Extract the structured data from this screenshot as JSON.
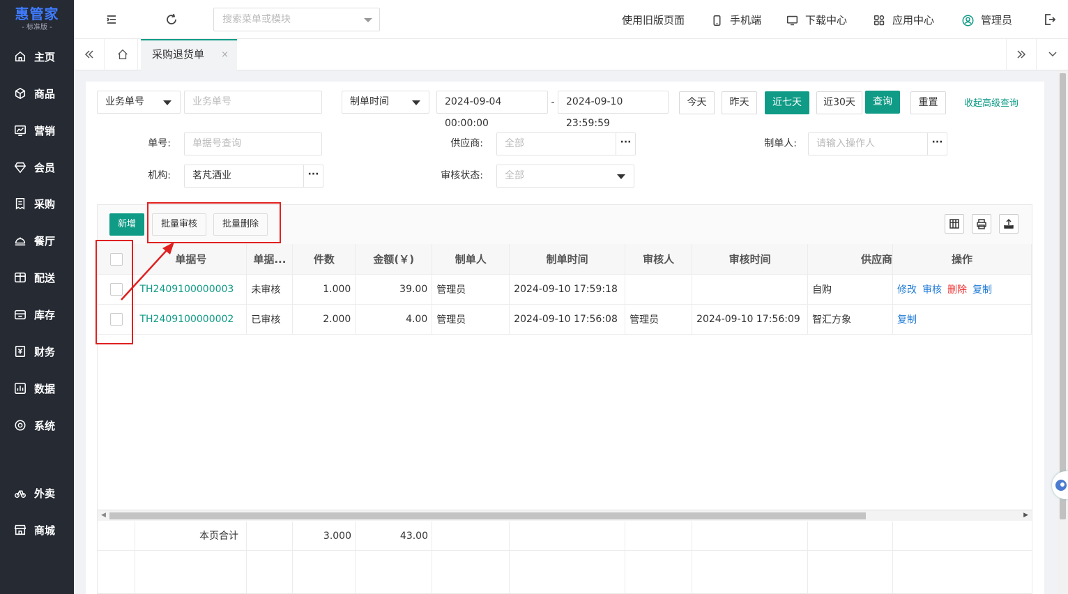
{
  "logo": {
    "brand": "惠管家",
    "edition": "- 标准版 -"
  },
  "sidebar": {
    "items": [
      {
        "label": "主页",
        "icon": "home-icon"
      },
      {
        "label": "商品",
        "icon": "box-icon"
      },
      {
        "label": "营销",
        "icon": "chart-icon"
      },
      {
        "label": "会员",
        "icon": "diamond-icon"
      },
      {
        "label": "采购",
        "icon": "receipt-icon"
      },
      {
        "label": "餐厅",
        "icon": "dome-icon"
      },
      {
        "label": "配送",
        "icon": "delivery-icon"
      },
      {
        "label": "库存",
        "icon": "warehouse-icon"
      },
      {
        "label": "财务",
        "icon": "finance-icon"
      },
      {
        "label": "数据",
        "icon": "data-icon"
      },
      {
        "label": "系统",
        "icon": "settings-icon"
      },
      {
        "label": "外卖",
        "icon": "bike-icon"
      },
      {
        "label": "商城",
        "icon": "store-icon"
      }
    ]
  },
  "topbar": {
    "search_placeholder": "搜索菜单或模块",
    "old_page": "使用旧版页面",
    "mobile": "手机端",
    "download": "下载中心",
    "apps": "应用中心",
    "user": "管理员"
  },
  "tabs": {
    "active": "采购退货单",
    "close": "×"
  },
  "filters": {
    "type_select": "业务单号",
    "type_placeholder": "业务单号",
    "time_select": "制单时间",
    "date_start": "2024-09-04 00:00:00",
    "date_sep": "-",
    "date_end": "2024-09-10 23:59:59",
    "today": "今天",
    "yesterday": "昨天",
    "last7": "近七天",
    "last30": "近30天",
    "query": "查询",
    "reset": "重置",
    "collapse": "收起高级查询",
    "order_no_label": "单号:",
    "order_no_placeholder": "单据号查询",
    "supplier_label": "供应商:",
    "supplier_placeholder": "全部",
    "creator_label": "制单人:",
    "creator_placeholder": "请输入操作人",
    "org_label": "机构:",
    "org_value": "茗芃酒业",
    "audit_label": "审核状态:",
    "audit_placeholder": "全部",
    "dots": "···"
  },
  "toolbar": {
    "add": "新增",
    "batch_audit": "批量审核",
    "batch_delete": "批量删除"
  },
  "table": {
    "headers": [
      "单据号",
      "单据...",
      "件数",
      "金额(￥)",
      "制单人",
      "制单时间",
      "审核人",
      "审核时间",
      "供应商",
      "操作"
    ],
    "rows": [
      {
        "no": "TH2409100000003",
        "status": "未审核",
        "qty": "1.000",
        "amount": "39.00",
        "creator": "管理员",
        "created": "2024-09-10 17:59:18",
        "auditor": "",
        "audited": "",
        "supplier": "自购",
        "ops": [
          "修改",
          "审核",
          "删除",
          "复制"
        ]
      },
      {
        "no": "TH2409100000002",
        "status": "已审核",
        "qty": "2.000",
        "amount": "4.00",
        "creator": "管理员",
        "created": "2024-09-10 17:56:08",
        "auditor": "管理员",
        "audited": "2024-09-10 17:56:09",
        "supplier": "智汇方象",
        "ops": [
          "复制"
        ]
      }
    ],
    "footer": {
      "label": "本页合计",
      "qty": "3.000",
      "amount": "43.00"
    }
  },
  "colors": {
    "sidebar_bg": "#252a33",
    "accent": "#0f9b86",
    "link": "#1e7ad6",
    "danger": "#e33333",
    "annotation": "#e02020"
  }
}
